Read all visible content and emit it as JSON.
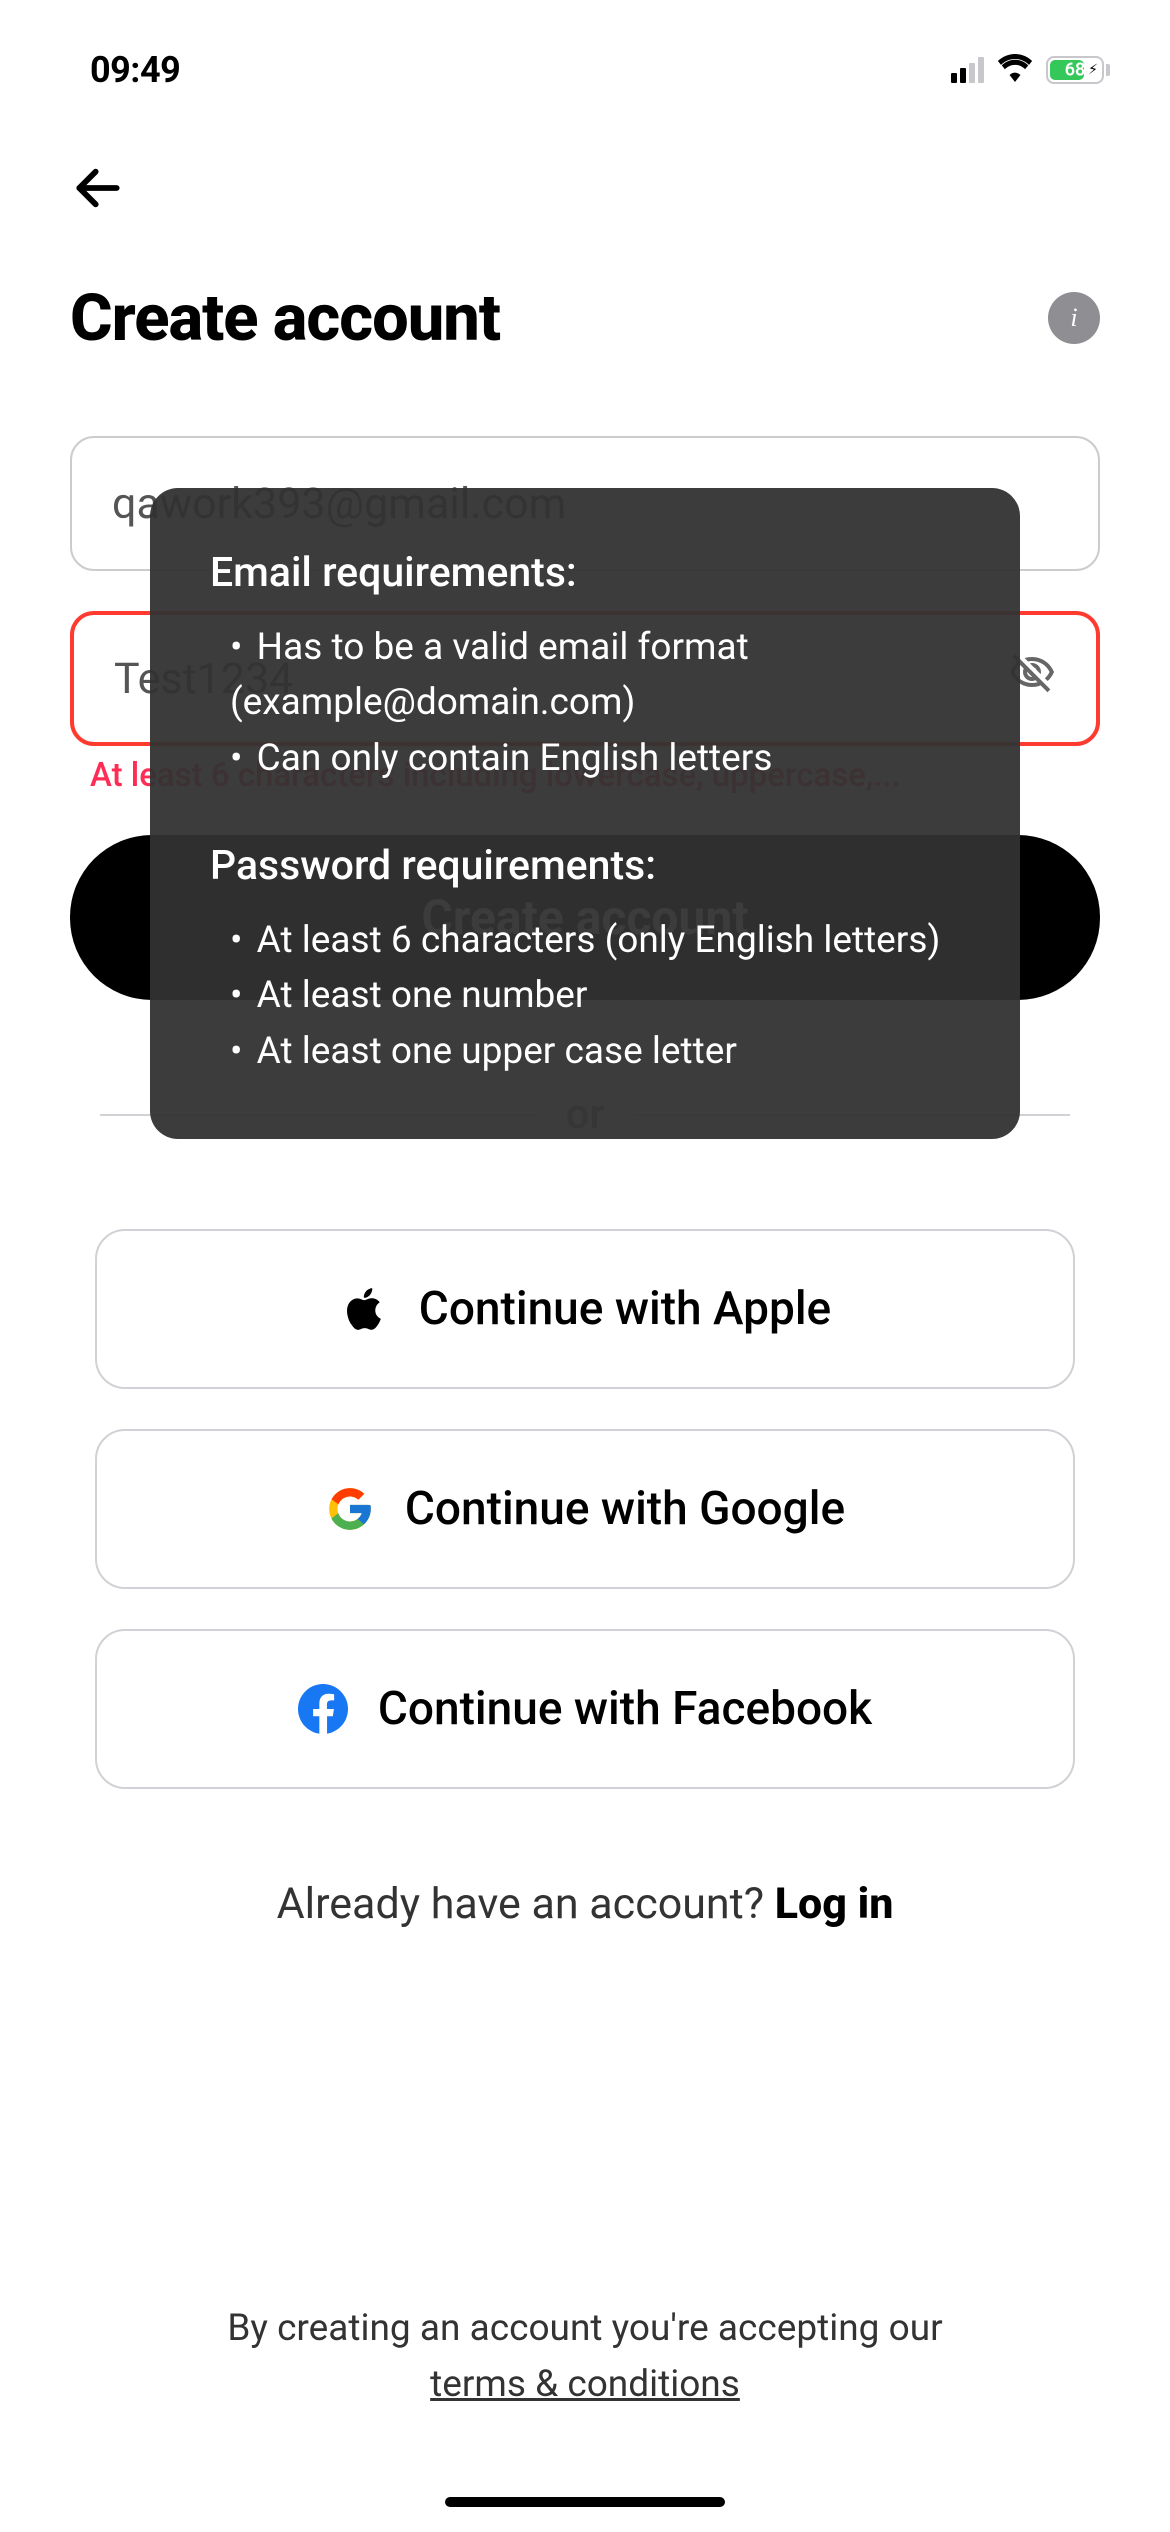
{
  "status": {
    "time": "09:49",
    "battery_percent": "68"
  },
  "header": {
    "title": "Create account"
  },
  "form": {
    "email_value": "qawork393@gmail.com",
    "password_value": "Test1234",
    "error_message": "At least 6 characters including lowercase, uppercase,...",
    "submit_label": "Create account"
  },
  "divider": {
    "text": "or"
  },
  "social": {
    "apple": "Continue with Apple",
    "google": "Continue with Google",
    "facebook": "Continue with Facebook"
  },
  "login": {
    "prompt": "Already have an account? ",
    "link": "Log in"
  },
  "terms": {
    "line1": "By creating an account you're accepting our",
    "link": "terms & conditions"
  },
  "tooltip": {
    "email_heading": "Email requirements:",
    "email_rule1": "Has to be a valid email format (example@domain.com)",
    "email_rule2": "Can only contain English letters",
    "password_heading": "Password requirements:",
    "password_rule1": "At least 6 characters (only English letters)",
    "password_rule2": "At least one number",
    "password_rule3": "At least one upper case letter"
  }
}
